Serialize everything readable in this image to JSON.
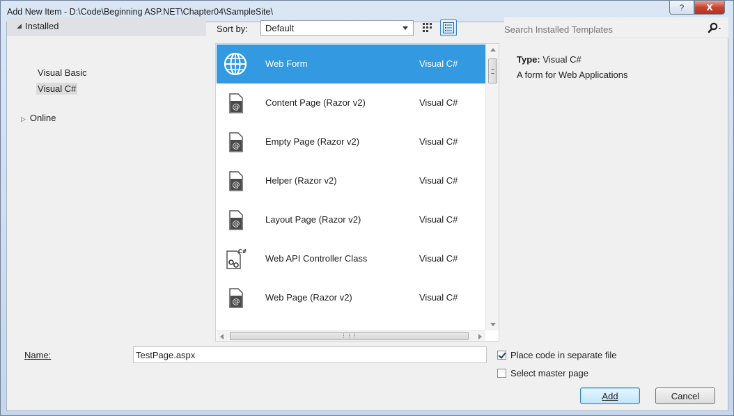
{
  "window": {
    "title": "Add New Item - D:\\Code\\Beginning ASP.NET\\Chapter04\\SampleSite\\",
    "help_glyph": "?",
    "close_glyph": "X"
  },
  "tree": {
    "installed_label": "Installed",
    "installed_expanded": true,
    "children": [
      "Visual Basic",
      "Visual C#"
    ],
    "selected_child": "Visual C#",
    "online_label": "Online"
  },
  "toolbar": {
    "sort_label": "Sort by:",
    "sort_value": "Default"
  },
  "templates": [
    {
      "name": "Web Form",
      "language": "Visual C#",
      "icon": "globe-icon",
      "selected": true
    },
    {
      "name": "Content Page (Razor v2)",
      "language": "Visual C#",
      "icon": "razor-page-icon",
      "selected": false
    },
    {
      "name": "Empty Page (Razor v2)",
      "language": "Visual C#",
      "icon": "razor-page-icon",
      "selected": false
    },
    {
      "name": "Helper (Razor v2)",
      "language": "Visual C#",
      "icon": "razor-page-icon",
      "selected": false
    },
    {
      "name": "Layout Page (Razor v2)",
      "language": "Visual C#",
      "icon": "razor-page-icon",
      "selected": false
    },
    {
      "name": "Web API Controller Class",
      "language": "Visual C#",
      "icon": "csharp-class-icon",
      "selected": false
    },
    {
      "name": "Web Page (Razor v2)",
      "language": "Visual C#",
      "icon": "razor-page-icon",
      "selected": false
    }
  ],
  "search": {
    "placeholder": "Search Installed Templates"
  },
  "details": {
    "type_label": "Type:",
    "type_value": "Visual C#",
    "description": "A form for Web Applications"
  },
  "form": {
    "name_label": "Name:",
    "name_value": "TestPage.aspx",
    "place_code_label": "Place code in separate file",
    "place_code_checked": true,
    "master_page_label": "Select master page",
    "master_page_checked": false
  },
  "buttons": {
    "add": "Add",
    "cancel": "Cancel"
  },
  "colors": {
    "selection": "#3399e0",
    "close_button": "#c94431"
  }
}
